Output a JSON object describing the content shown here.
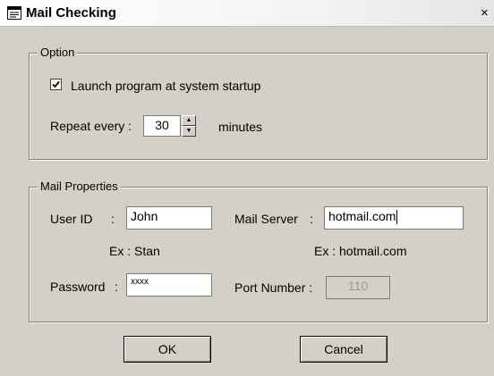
{
  "window": {
    "title": "Mail Checking",
    "close_glyph": "×"
  },
  "option": {
    "legend": "Option",
    "launch_label": "Launch program at system startup",
    "launch_checked": true,
    "repeat_label": "Repeat every :",
    "repeat_value": "30",
    "repeat_unit": "minutes"
  },
  "mail": {
    "legend": "Mail Properties",
    "user_id_label": "User ID",
    "user_id_colon": ":",
    "user_id_value": "John",
    "user_id_example": "Ex : Stan",
    "mail_server_label": "Mail Server",
    "mail_server_colon": ":",
    "mail_server_value": "hotmail.com",
    "mail_server_example": "Ex : hotmail.com",
    "password_label": "Password",
    "password_colon": ":",
    "password_value": "xxxx",
    "port_label": "Port Number :",
    "port_value": "110"
  },
  "buttons": {
    "ok": "OK",
    "cancel": "Cancel"
  }
}
